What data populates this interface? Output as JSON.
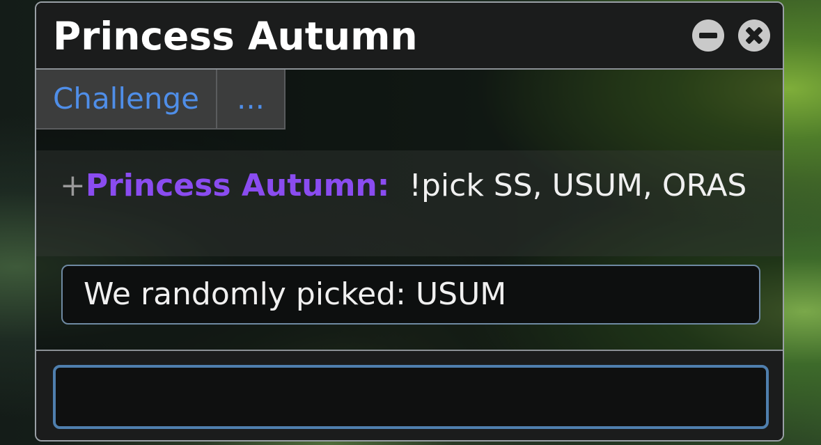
{
  "window": {
    "title": "Princess Autumn",
    "controls": [
      "minimize-icon",
      "close-icon"
    ]
  },
  "tabs": [
    {
      "label": "Challenge"
    },
    {
      "label": "..."
    }
  ],
  "message": {
    "rank": "+",
    "author": "Princess Autumn:",
    "text": "!pick SS, USUM, ORAS"
  },
  "result": {
    "text": "We randomly picked:  USUM"
  },
  "composer": {
    "value": ""
  },
  "colors": {
    "link": "#4f8ee8",
    "author": "#8a4cf0",
    "input_border": "#4f7fae"
  }
}
